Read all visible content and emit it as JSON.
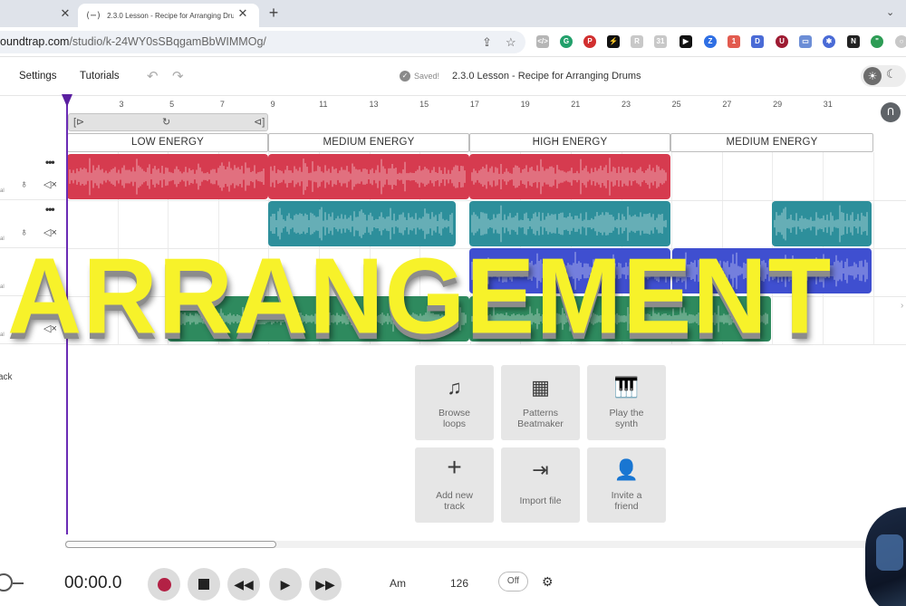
{
  "browser": {
    "prev_tab_close": "✕",
    "tab_icon": "(⋯)",
    "tab_title": "2.3.0 Lesson - Recipe for Arranging Drums",
    "tab_close": "✕",
    "new_tab": "+",
    "url_host": "oundtrap.com",
    "url_path": "/studio/k-24WY0sSBqgamBbWIMMOg/"
  },
  "header": {
    "settings": "Settings",
    "tutorials": "Tutorials",
    "undo_icon": "↶",
    "redo_icon": "↷",
    "saved_mark": "✓",
    "saved": "Saved!",
    "title": "2.3.0 Lesson - Recipe for Arranging Drums"
  },
  "ruler": [
    "3",
    "5",
    "7",
    "9",
    "11",
    "13",
    "15",
    "17",
    "19",
    "21",
    "23",
    "25",
    "27",
    "29",
    "31"
  ],
  "sections": [
    "LOW ENERGY",
    "MEDIUM ENERGY",
    "HIGH ENERGY",
    "MEDIUM ENERGY"
  ],
  "tracks": [
    {
      "tiny": "al"
    },
    {
      "tiny": "al"
    },
    {
      "tiny": "al"
    },
    {
      "tiny": "al"
    }
  ],
  "track_controls": {
    "dots": "•••",
    "headphones": "🎧",
    "mute": "🔇"
  },
  "add_track": "ack",
  "overlay_title": "ARRANGEMENT",
  "cards": [
    {
      "icon": "♫",
      "label1": "Browse",
      "label2": "loops"
    },
    {
      "icon": "▦",
      "label1": "Patterns",
      "label2": "Beatmaker"
    },
    {
      "icon": "🎹",
      "label1": "Play the",
      "label2": "synth"
    },
    {
      "icon": "+",
      "label1": "Add new",
      "label2": "track"
    },
    {
      "icon": "⇥",
      "label1": "Import file",
      "label2": ""
    },
    {
      "icon": "👤",
      "label1": "Invite a",
      "label2": "friend"
    }
  ],
  "transport": {
    "time": "00:00.0",
    "key": "Am",
    "bpm": "126",
    "metronome": "Off"
  },
  "colors": {
    "red_clip": "#d63b4f",
    "teal_clip": "#2d8f9b",
    "blue_clip": "#3f4fd0",
    "green_clip": "#2e8a5e",
    "overlay": "#f7f22a"
  }
}
